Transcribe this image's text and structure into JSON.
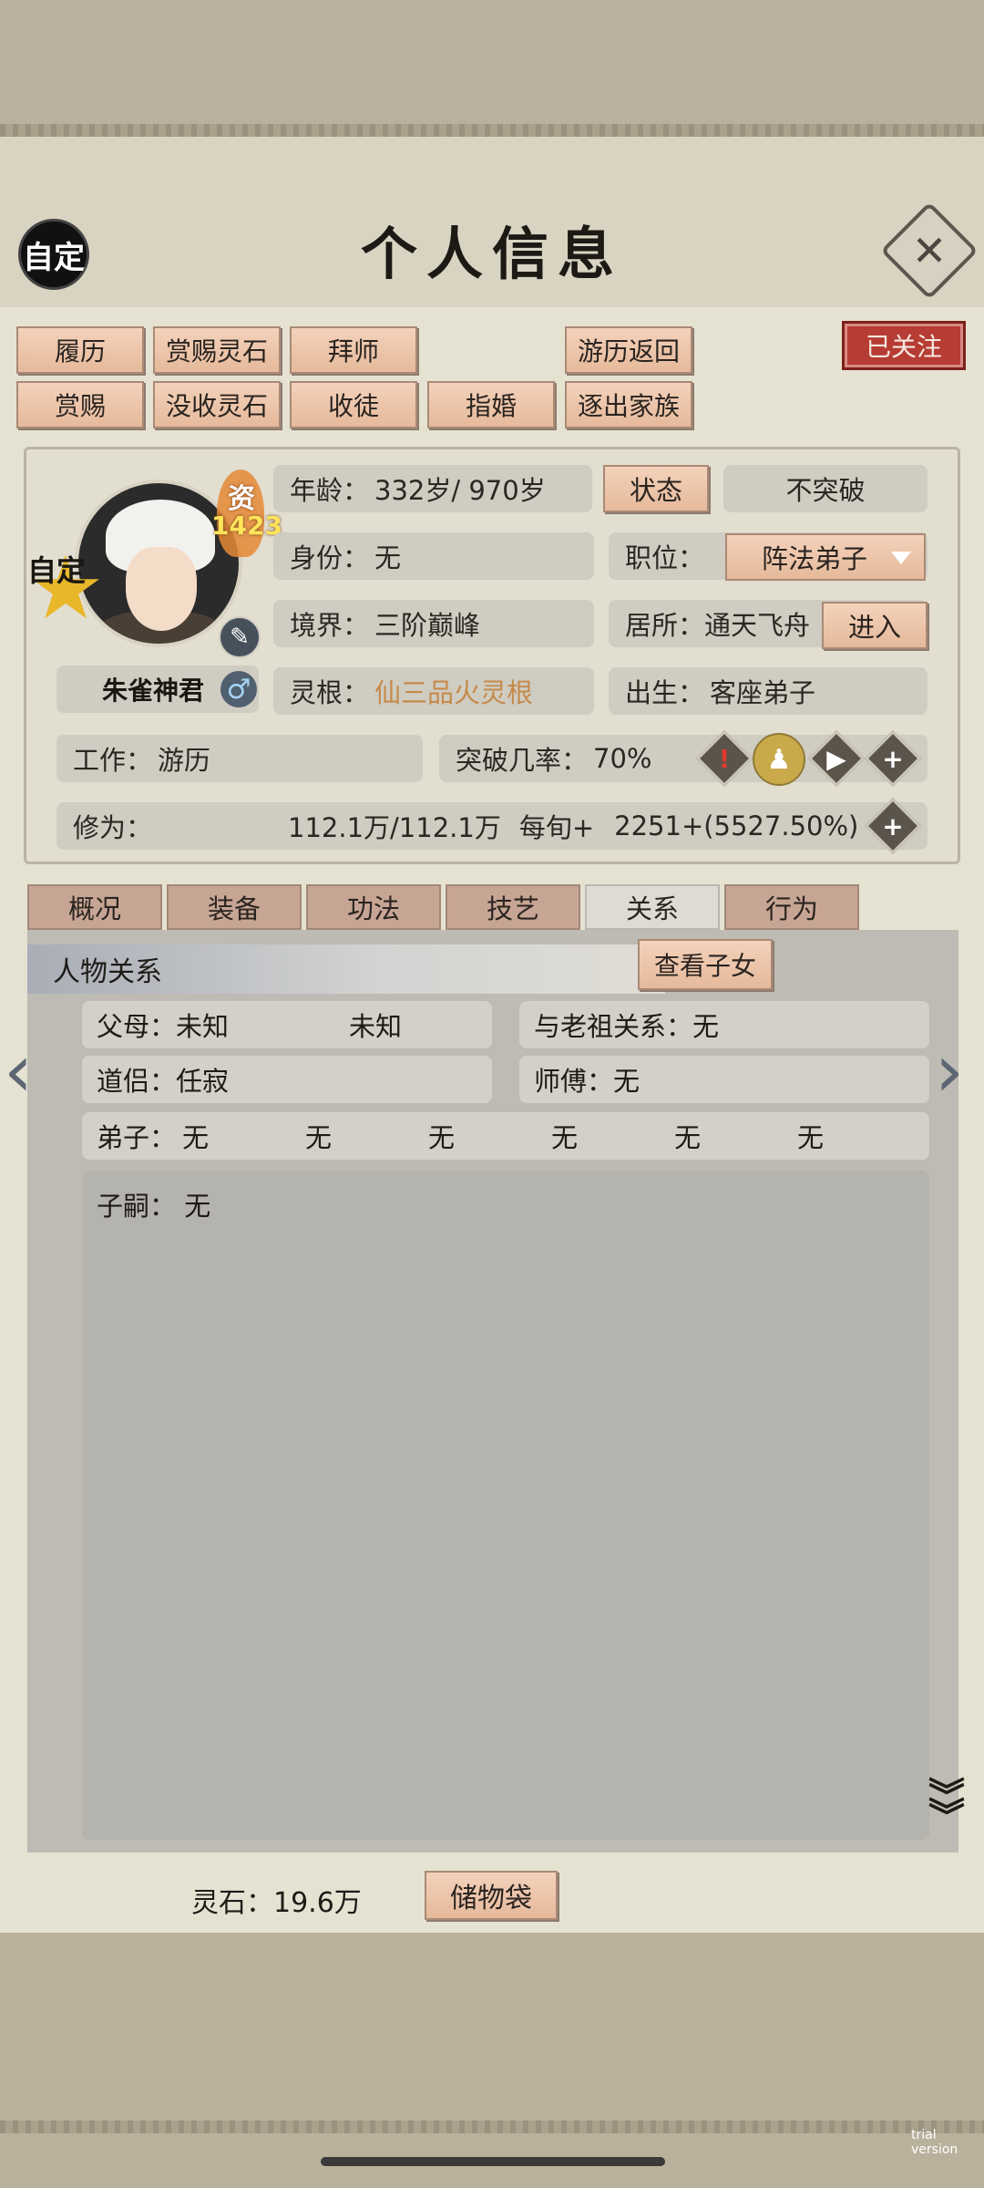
{
  "header": {
    "title": "个人信息",
    "custom_label": "自定",
    "close_icon": "close-x-icon"
  },
  "actions": {
    "row1": [
      "履历",
      "赏赐灵石",
      "拜师",
      "游历返回"
    ],
    "row2": [
      "赏赐",
      "没收灵石",
      "收徒",
      "指婚",
      "逐出家族"
    ],
    "followed": "已关注"
  },
  "profile": {
    "aptitude_label": "资",
    "aptitude_value": "1423",
    "star_badge": "自定",
    "name": "朱雀神君",
    "age_label": "年龄：",
    "age_value": "332岁/ 970岁",
    "status_button": "状态",
    "breakthrough_value": "不突破",
    "identity_label": "身份：",
    "identity_value": "无",
    "position_label": "职位：",
    "position_value": "阵法弟子",
    "realm_label": "境界：",
    "realm_value": "三阶巅峰",
    "residence_label": "居所：通天飞舟",
    "enter_button": "进入",
    "root_label": "灵根：",
    "root_value": "仙三品火灵根",
    "root_color": "#c58a4a",
    "birth_label": "出生：",
    "birth_value": "客座弟子",
    "work_label": "工作：",
    "work_value": "游历",
    "rate_label": "突破几率：",
    "rate_value": "70%",
    "cultivation_label": "修为：",
    "cultivation_value": "112.1万/112.1万",
    "per_period_label": "每旬+",
    "per_period_value": "2251+(5527.50%)"
  },
  "tabs": [
    "概况",
    "装备",
    "功法",
    "技艺",
    "关系",
    "行为"
  ],
  "active_tab": "关系",
  "relations": {
    "section_title": "人物关系",
    "view_children_button": "查看子女",
    "parents_label": "父母：",
    "parent1": "未知",
    "parent2": "未知",
    "ancestor_label": "与老祖关系：",
    "ancestor_value": "无",
    "partner_label": "道侣：",
    "partner_value": "任寂",
    "master_label": "师傅：",
    "master_value": "无",
    "disciples_label": "弟子：",
    "disciples": [
      "无",
      "无",
      "无",
      "无",
      "无",
      "无"
    ],
    "heirs_label": "子嗣：",
    "heirs_value": "无"
  },
  "footer": {
    "spirit_stone": "灵石：19.6万",
    "bag_button": "储物袋"
  },
  "watermark": "trial version"
}
